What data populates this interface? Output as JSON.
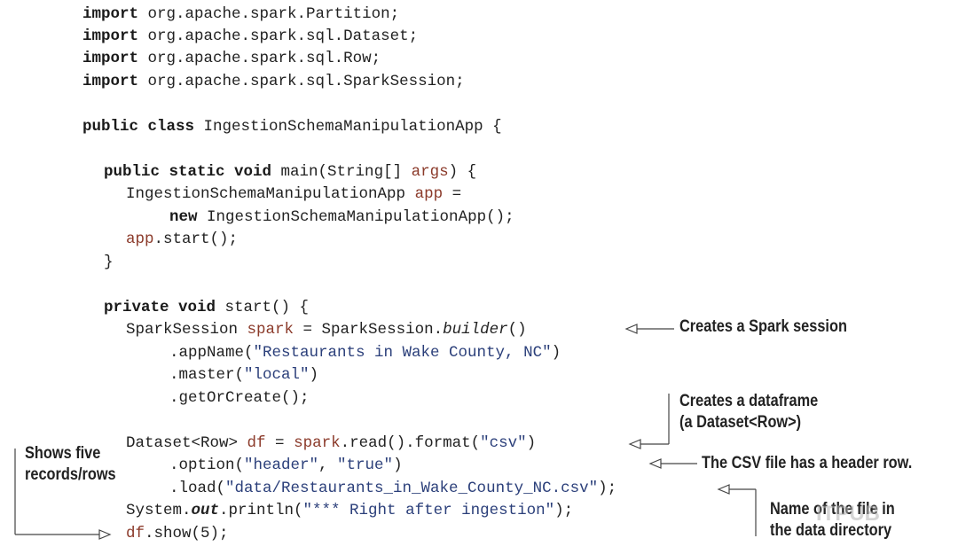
{
  "code": {
    "import_kw": "import",
    "imports": [
      "org.apache.spark.Partition;",
      "org.apache.spark.sql.Dataset;",
      "org.apache.spark.sql.Row;",
      "org.apache.spark.sql.SparkSession;"
    ],
    "class_kw": "public class",
    "class_decl": "IngestionSchemaManipulationApp {",
    "main_kw": "public static void",
    "main_decl": "main(String[] ",
    "main_args": "args",
    "main_end": ") {",
    "app_decl_type": "IngestionSchemaManipulationApp ",
    "app_var": "app",
    "app_decl_eq": " =",
    "new_kw": "new",
    "new_expr": " IngestionSchemaManipulationApp();",
    "app_start": ".start();",
    "close_brace": "}",
    "private_kw": "private void",
    "start_decl": "start() {",
    "spark_type": "SparkSession ",
    "spark_var": "spark",
    "spark_eq": " = SparkSession.",
    "builder": "builder",
    "builder_end": "()",
    "appname_pre": ".appName(",
    "appname_str": "\"Restaurants in Wake County, NC\"",
    "appname_end": ")",
    "master_pre": ".master(",
    "master_str": "\"local\"",
    "master_end": ")",
    "getorcreate": ".getOrCreate();",
    "dataset_decl": "Dataset<Row> ",
    "df_var": "df",
    "df_eq": " = ",
    "read_part": ".read().format(",
    "csv_str": "\"csv\"",
    "read_end": ")",
    "option_pre": ".option(",
    "header_str": "\"header\"",
    "comma": ", ",
    "true_str": "\"true\"",
    "option_end": ")",
    "load_pre": ".load(",
    "load_str": "\"data/Restaurants_in_Wake_County_NC.csv\"",
    "load_end": ");",
    "sysout_pre": "System.",
    "out_kw": "out",
    "println_pre": ".println(",
    "println_str": "\"*** Right after ingestion\"",
    "println_end": ");",
    "show_end": ".show(5);"
  },
  "annotations": {
    "spark_session": "Creates a Spark session",
    "dataframe": "Creates a dataframe\n(a Dataset<Row>)",
    "header": "The CSV file has a header row.",
    "file_name": "Name of the file in\nthe data directory",
    "shows": "Shows five\nrecords/rows"
  },
  "watermark": "ITPUB"
}
